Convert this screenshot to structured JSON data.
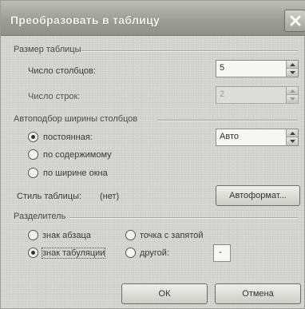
{
  "dialog": {
    "title": "Преобразовать в таблицу",
    "close_glyph": "✕"
  },
  "table_size": {
    "group_label": "Размер таблицы",
    "columns_label": "Число столбцов:",
    "columns_value": "5",
    "rows_label": "Число строк:",
    "rows_value": "2"
  },
  "autofit": {
    "group_label": "Автоподбор ширины столбцов",
    "fixed_label": "постоянная:",
    "fixed_value": "Авто",
    "content_label": "по содержимому",
    "window_label": "по ширине окна",
    "selected": "fixed"
  },
  "style": {
    "label": "Стиль таблицы:",
    "value": "(нет)",
    "autoformat_button": "Автоформат..."
  },
  "separator": {
    "group_label": "Разделитель",
    "paragraph_label": "знак абзаца",
    "semicolon_label": "точка с запятой",
    "tab_label": "знак табуляции",
    "other_label": "другой:",
    "other_value": "-",
    "selected": "tab"
  },
  "buttons": {
    "ok": "ОК",
    "cancel": "Отмена"
  },
  "colors": {
    "titlebar": "#9e9e99",
    "dialog_bg": "#d6d6d2"
  }
}
